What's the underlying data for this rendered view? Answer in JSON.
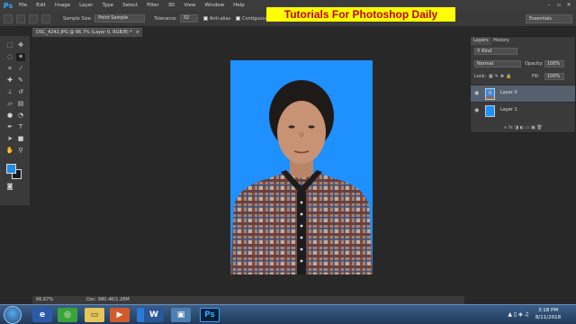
{
  "app": {
    "logo": "Ps"
  },
  "menu": [
    "File",
    "Edit",
    "Image",
    "Layer",
    "Type",
    "Select",
    "Filter",
    "3D",
    "View",
    "Window",
    "Help"
  ],
  "overlay": {
    "title": "Tutorials For Photoshop Daily"
  },
  "options": {
    "sample_size_label": "Sample Size:",
    "sample_size_value": "Point Sample",
    "tolerance_label": "Tolerance:",
    "tolerance_value": "32",
    "anti_alias_label": "Anti-alias",
    "contiguous_label": "Contiguous",
    "workspace": "Essentials"
  },
  "document": {
    "tab_title": "DSC_4242.JPG @ 66.7% (Layer 0, RGB/8) *",
    "close_glyph": "×"
  },
  "status": {
    "zoom": "66.67%",
    "doc_size": "Doc: 980.4K/1.28M"
  },
  "layers_panel": {
    "tab_layers": "Layers",
    "tab_history": "History",
    "kind_label": "Kind",
    "blend_mode": "Normal",
    "opacity_label": "Opacity:",
    "opacity_value": "100%",
    "lock_label": "Lock:",
    "fill_label": "Fill:",
    "fill_value": "100%",
    "layers": [
      {
        "name": "Layer 0",
        "thumb": "photo"
      },
      {
        "name": "Layer 1",
        "thumb": "#1e90ff"
      }
    ],
    "footer_icons": "∞  fx  ◨  ◐  ▭  ▣  🗑"
  },
  "colors": {
    "foreground": "#1f8ce6",
    "background": "#1a1a1a",
    "canvas_fill": "#1e90ff",
    "overlay_bg": "#ffff00",
    "overlay_text": "#c00000"
  },
  "taskbar": {
    "time": "3:18 PM",
    "date": "8/11/2018",
    "ps_label": "Ps",
    "word_label": "W"
  }
}
